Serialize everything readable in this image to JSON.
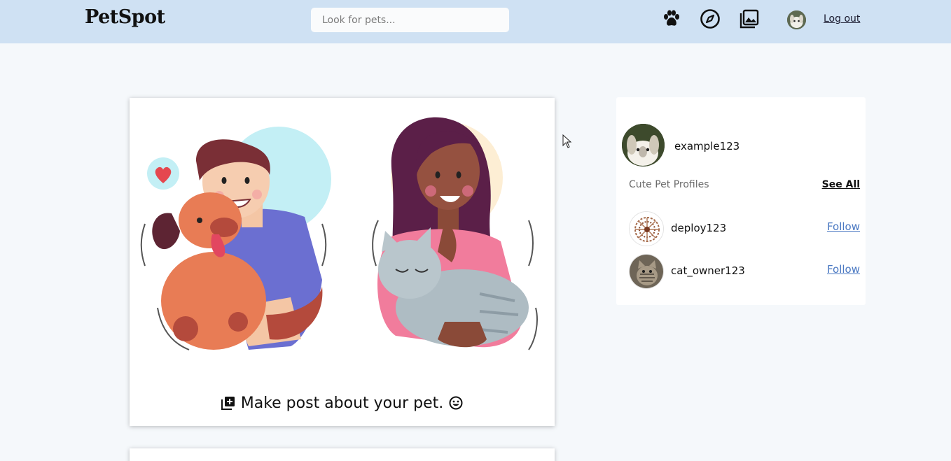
{
  "header": {
    "logo": "PetSpot",
    "search_placeholder": "Look for pets...",
    "logout_label": "Log out",
    "icons": [
      "paw-icon",
      "compass-icon",
      "gallery-icon"
    ]
  },
  "post_card": {
    "make_post_label": "Make post about your pet."
  },
  "sidebar": {
    "current_user": "example123",
    "section_title": "Cute Pet Profiles",
    "see_all_label": "See All",
    "profiles": [
      {
        "username": "deploy123",
        "follow_label": "Follow"
      },
      {
        "username": "cat_owner123",
        "follow_label": "Follow"
      }
    ]
  },
  "colors": {
    "header_bg": "#cfe1f3",
    "page_bg": "#f5f8fb",
    "link_blue": "#4a78c2"
  }
}
